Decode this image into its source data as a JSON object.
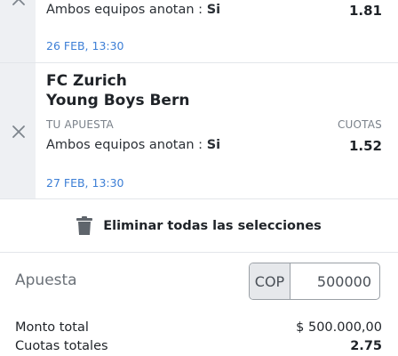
{
  "selections": [
    {
      "market": "Ambos equipos anotan :",
      "pick": "Si",
      "odds": "1.81",
      "date": "26 FEB, 13:30"
    },
    {
      "team_home": "FC Zurich",
      "team_away": "Young Boys Bern",
      "bet_label": "TU APUESTA",
      "odds_label": "CUOTAS",
      "market": "Ambos equipos anotan :",
      "pick": "Si",
      "odds": "1.52",
      "date": "27 FEB, 13:30"
    }
  ],
  "delete_all": {
    "label": "Eliminar todas las selecciones",
    "icon": "trash-icon"
  },
  "stake": {
    "label": "Apuesta",
    "currency": "COP",
    "value": "500000"
  },
  "summary": {
    "total_amount_label": "Monto total",
    "total_amount_value": "$ 500.000,00",
    "total_odds_label": "Cuotas totales",
    "total_odds_value": "2.75"
  },
  "colors": {
    "accent_date": "#3d7fd6",
    "sidebar": "#eef0f3"
  }
}
